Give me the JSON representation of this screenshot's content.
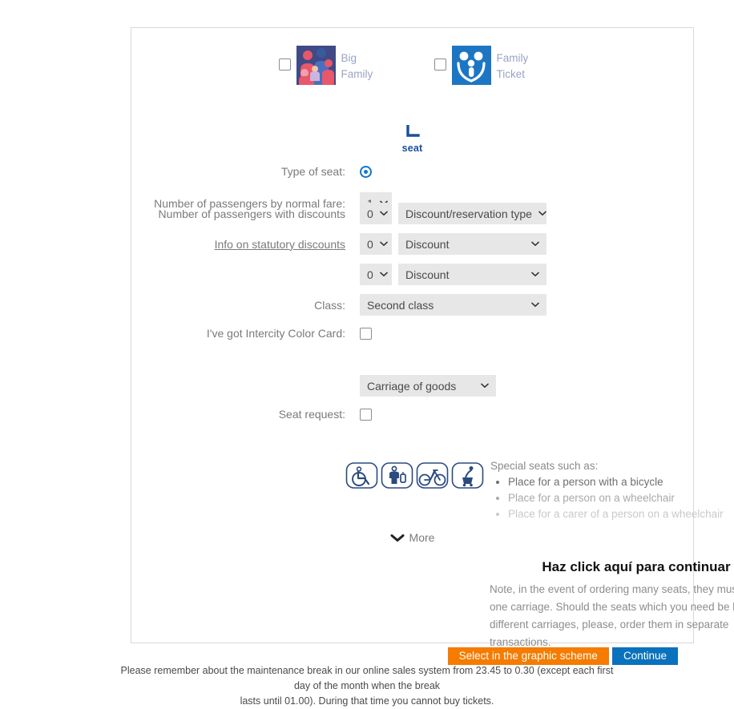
{
  "options": [
    {
      "label": "Big Family",
      "icon": "big-family-photo",
      "checked": false
    },
    {
      "label": "Family Ticket",
      "icon": "family-ticket-icon",
      "checked": false
    }
  ],
  "seat": {
    "icon": "seat-icon",
    "label": "seat"
  },
  "form": {
    "type_of_seat_label": "Type of seat:",
    "type_of_seat_value": "selected",
    "normal_fare_label": "Number of passengers by normal fare:",
    "normal_fare_value": "1",
    "discount_passengers_label": "Number of passengers with discounts",
    "info_link": "Info on statutory discounts",
    "discount_rows": [
      {
        "count": "0",
        "type": "Discount/reservation type"
      },
      {
        "count": "0",
        "type": "Discount"
      },
      {
        "count": "0",
        "type": "Discount"
      }
    ],
    "class_label": "Class:",
    "class_value": "Second class",
    "color_card_label": "I've got Intercity Color Card:",
    "color_card_checked": false,
    "carriage_value": "Carriage of goods",
    "seat_request_label": "Seat request:",
    "seat_request_checked": false
  },
  "special": {
    "title": "Special seats such as:",
    "items": [
      "Place for a person with a bicycle",
      "Place for a person on a wheelchair",
      "Place for a carer of a person on a wheelchair"
    ],
    "icons": [
      "wheelchair-icon",
      "person-with-luggage-icon",
      "bicycle-icon",
      "person-with-stroller-icon"
    ],
    "more_label": "More",
    "more_icon": "chevron-down-icon"
  },
  "annotation": {
    "text": "Haz click aquí para continuar",
    "arrow": "curved-arrow-down"
  },
  "note": "Note, in the event of ordering many seats, they must be in one carriage. Should the seats which you need be located in different carriages, please, order them in separate transactions.",
  "buttons": {
    "graphic_scheme": "Select in the graphic scheme",
    "continue": "Continue"
  },
  "footer": {
    "line1": "Please remember about the maintenance break in our online sales system from 23.45 to 0.30 (except each first day of the month when the break",
    "line2": "lasts until 01.00). During that time you cannot buy tickets."
  },
  "colors": {
    "orange": "#f57c00",
    "blue": "#0a72bd",
    "accent_blue": "#1276cf",
    "select_bg": "#e7e7e7"
  }
}
